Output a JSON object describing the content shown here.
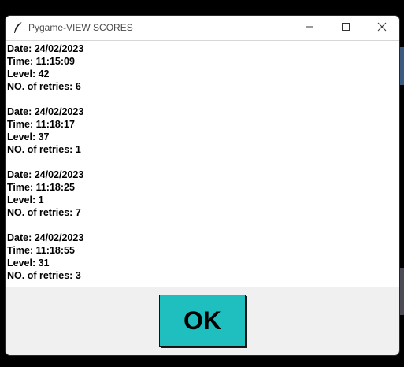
{
  "window": {
    "title": "Pygame-VIEW SCORES",
    "icon": "feather-icon"
  },
  "titlebar_buttons": {
    "minimize_icon": "minimize-icon",
    "maximize_icon": "maximize-icon",
    "close_icon": "close-icon"
  },
  "scores": [
    {
      "date": "Date: 24/02/2023",
      "time": "Time: 11:15:09",
      "level": "Level: 42",
      "retries": "NO. of retries: 6"
    },
    {
      "date": "Date: 24/02/2023",
      "time": "Time: 11:18:17",
      "level": "Level: 37",
      "retries": "NO. of retries: 1"
    },
    {
      "date": "Date: 24/02/2023",
      "time": "Time: 11:18:25",
      "level": "Level: 1",
      "retries": "NO. of retries: 7"
    },
    {
      "date": "Date: 24/02/2023",
      "time": "Time: 11:18:55",
      "level": "Level: 31",
      "retries": "NO. of retries: 3"
    }
  ],
  "ok_button": {
    "label": "OK",
    "color": "#20bfbf"
  }
}
